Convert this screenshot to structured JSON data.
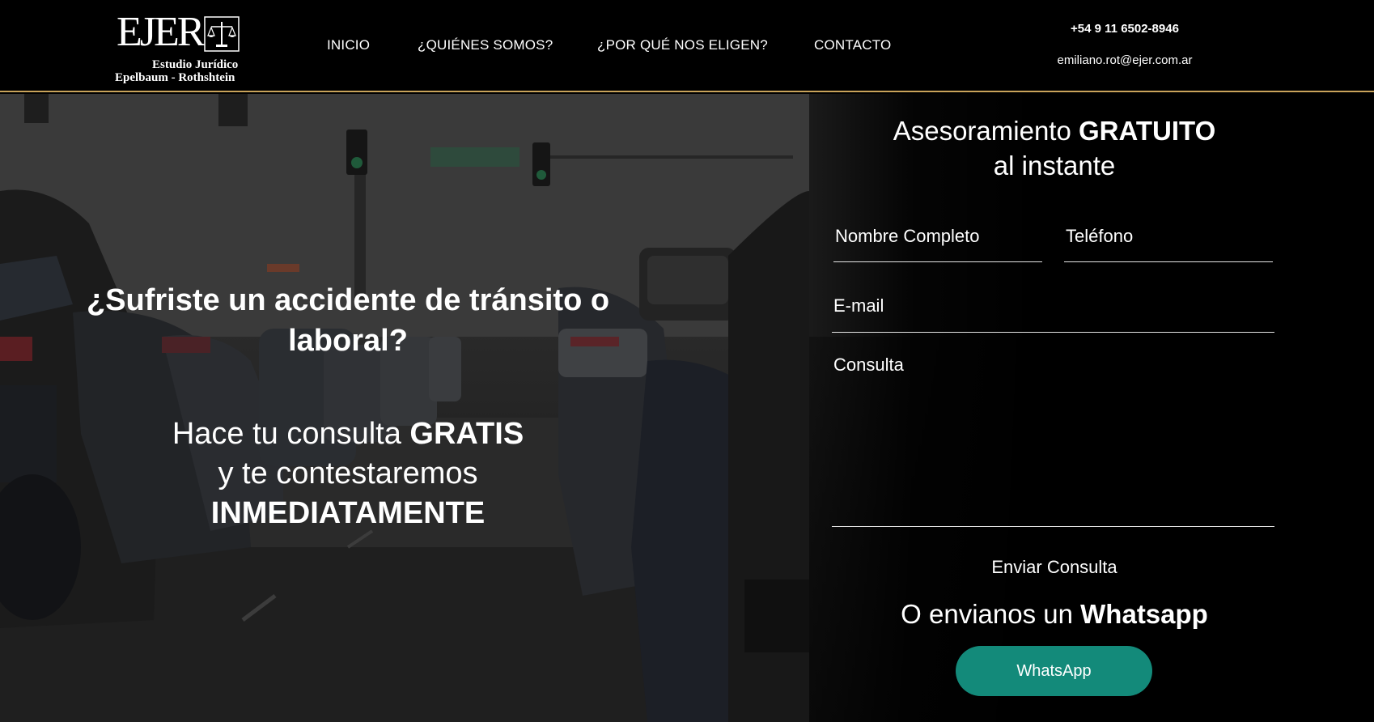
{
  "header": {
    "logo": {
      "main": "EJER",
      "line1": "Estudio Jurídico",
      "line2": "Epelbaum - Rothshtein"
    },
    "nav": [
      {
        "label": "INICIO"
      },
      {
        "label": "¿QUIÉNES SOMOS?"
      },
      {
        "label": "¿POR QUÉ NOS ELIGEN?"
      },
      {
        "label": "CONTACTO"
      }
    ],
    "phone": "+54 9 11 6502-8946",
    "email": "emiliano.rot@ejer.com.ar",
    "accent_color": "#c9a35a"
  },
  "hero": {
    "headline": "¿Sufriste un accidente de tránsito o laboral?",
    "sub": {
      "part1": "Hace tu consulta ",
      "bold1": "GRATIS",
      "part2": "y te contestaremos",
      "bold2": "INMEDIATAMENTE"
    }
  },
  "form": {
    "title_part1": "Asesoramiento ",
    "title_bold": "GRATUITO",
    "title_part2": "al instante",
    "name_placeholder": "Nombre Completo",
    "phone_placeholder": "Teléfono",
    "email_placeholder": "E-mail",
    "message_placeholder": "Consulta",
    "submit_label": "Enviar Consulta"
  },
  "whatsapp": {
    "title_part1": "O envianos un ",
    "title_bold": "Whatsapp",
    "button_label": "WhatsApp",
    "button_color": "#138a7a"
  }
}
